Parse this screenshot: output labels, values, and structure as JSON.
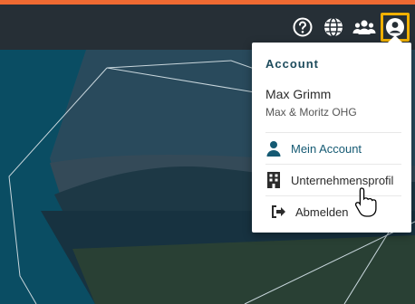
{
  "colors": {
    "accent_bar": "#ee6a32",
    "topbar_bg": "#262f36",
    "focus_outline": "#f0b000",
    "account_heading": "#1d4b5c",
    "link_text": "#155a73"
  },
  "topbar": {
    "icons": [
      "help-icon",
      "globe-icon",
      "users-icon",
      "account-circle-icon"
    ]
  },
  "account_menu": {
    "heading": "Account",
    "user_name": "Max Grimm",
    "company": "Max & Moritz OHG",
    "items": [
      {
        "label": "Mein Account",
        "icon": "person-icon"
      },
      {
        "label": "Unternehmensprofil",
        "icon": "building-icon"
      },
      {
        "label": "Abmelden",
        "icon": "sign-out-icon"
      }
    ]
  }
}
